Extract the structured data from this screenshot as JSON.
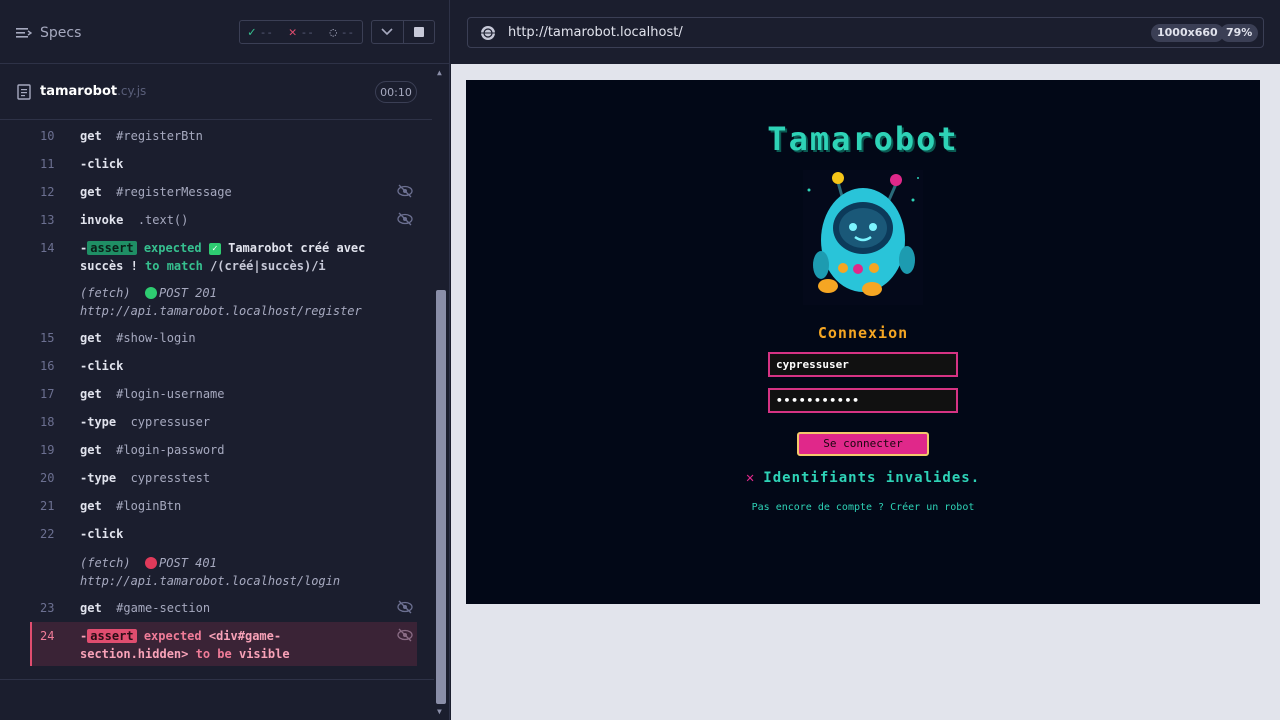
{
  "topbar": {
    "specs_label": "Specs",
    "passed": "--",
    "failed": "--",
    "pending": "--"
  },
  "spec": {
    "name": "tamarobot",
    "ext": ".cy.js",
    "duration": "00:10"
  },
  "commands": [
    {
      "num": "10",
      "name": "get",
      "arg": "#registerBtn"
    },
    {
      "num": "11",
      "name": "-click",
      "arg": ""
    },
    {
      "num": "12",
      "name": "get",
      "arg": "#registerMessage"
    },
    {
      "num": "13",
      "name": "invoke",
      "arg": ".text()"
    },
    {
      "num": "14",
      "badge": "assert",
      "w1": "expected",
      "v1": "Tamarobot créé avec",
      "v2": "succès !",
      "w2": "to match",
      "v3": "/(créé|succès)/i"
    },
    {
      "fetch": "(fetch)",
      "method": "POST 201",
      "url": "http://api.tamarobot.localhost/register"
    },
    {
      "num": "15",
      "name": "get",
      "arg": "#show-login"
    },
    {
      "num": "16",
      "name": "-click",
      "arg": ""
    },
    {
      "num": "17",
      "name": "get",
      "arg": "#login-username"
    },
    {
      "num": "18",
      "name": "-type",
      "arg": "cypressuser"
    },
    {
      "num": "19",
      "name": "get",
      "arg": "#login-password"
    },
    {
      "num": "20",
      "name": "-type",
      "arg": "cypresstest"
    },
    {
      "num": "21",
      "name": "get",
      "arg": "#loginBtn"
    },
    {
      "num": "22",
      "name": "-click",
      "arg": ""
    },
    {
      "fetch": "(fetch)",
      "method": "POST 401",
      "url": "http://api.tamarobot.localhost/login"
    },
    {
      "num": "23",
      "name": "get",
      "arg": "#game-section"
    },
    {
      "num": "24",
      "badge": "assert",
      "w1": "expected",
      "v1": "<div#game-",
      "v2": "section.hidden>",
      "w2": "to be",
      "v3": "visible"
    }
  ],
  "url_bar": {
    "url": "http://tamarobot.localhost/",
    "viewport": "1000x660",
    "zoom": "79%"
  },
  "app": {
    "title": "Tamarobot",
    "login_title": "Connexion",
    "username_value": "cypressuser",
    "password_value": "•••••••••••",
    "login_button": "Se connecter",
    "error_icon": "✕",
    "error_message": "Identifiants invalides.",
    "register_link": "Pas encore de compte ? Créer un robot"
  },
  "colors": {
    "accent_teal": "#2ed3b7",
    "accent_pink": "#e0288a",
    "accent_orange": "#f5a623",
    "pass_green": "#36c08f",
    "fail_red": "#e04d6f"
  }
}
